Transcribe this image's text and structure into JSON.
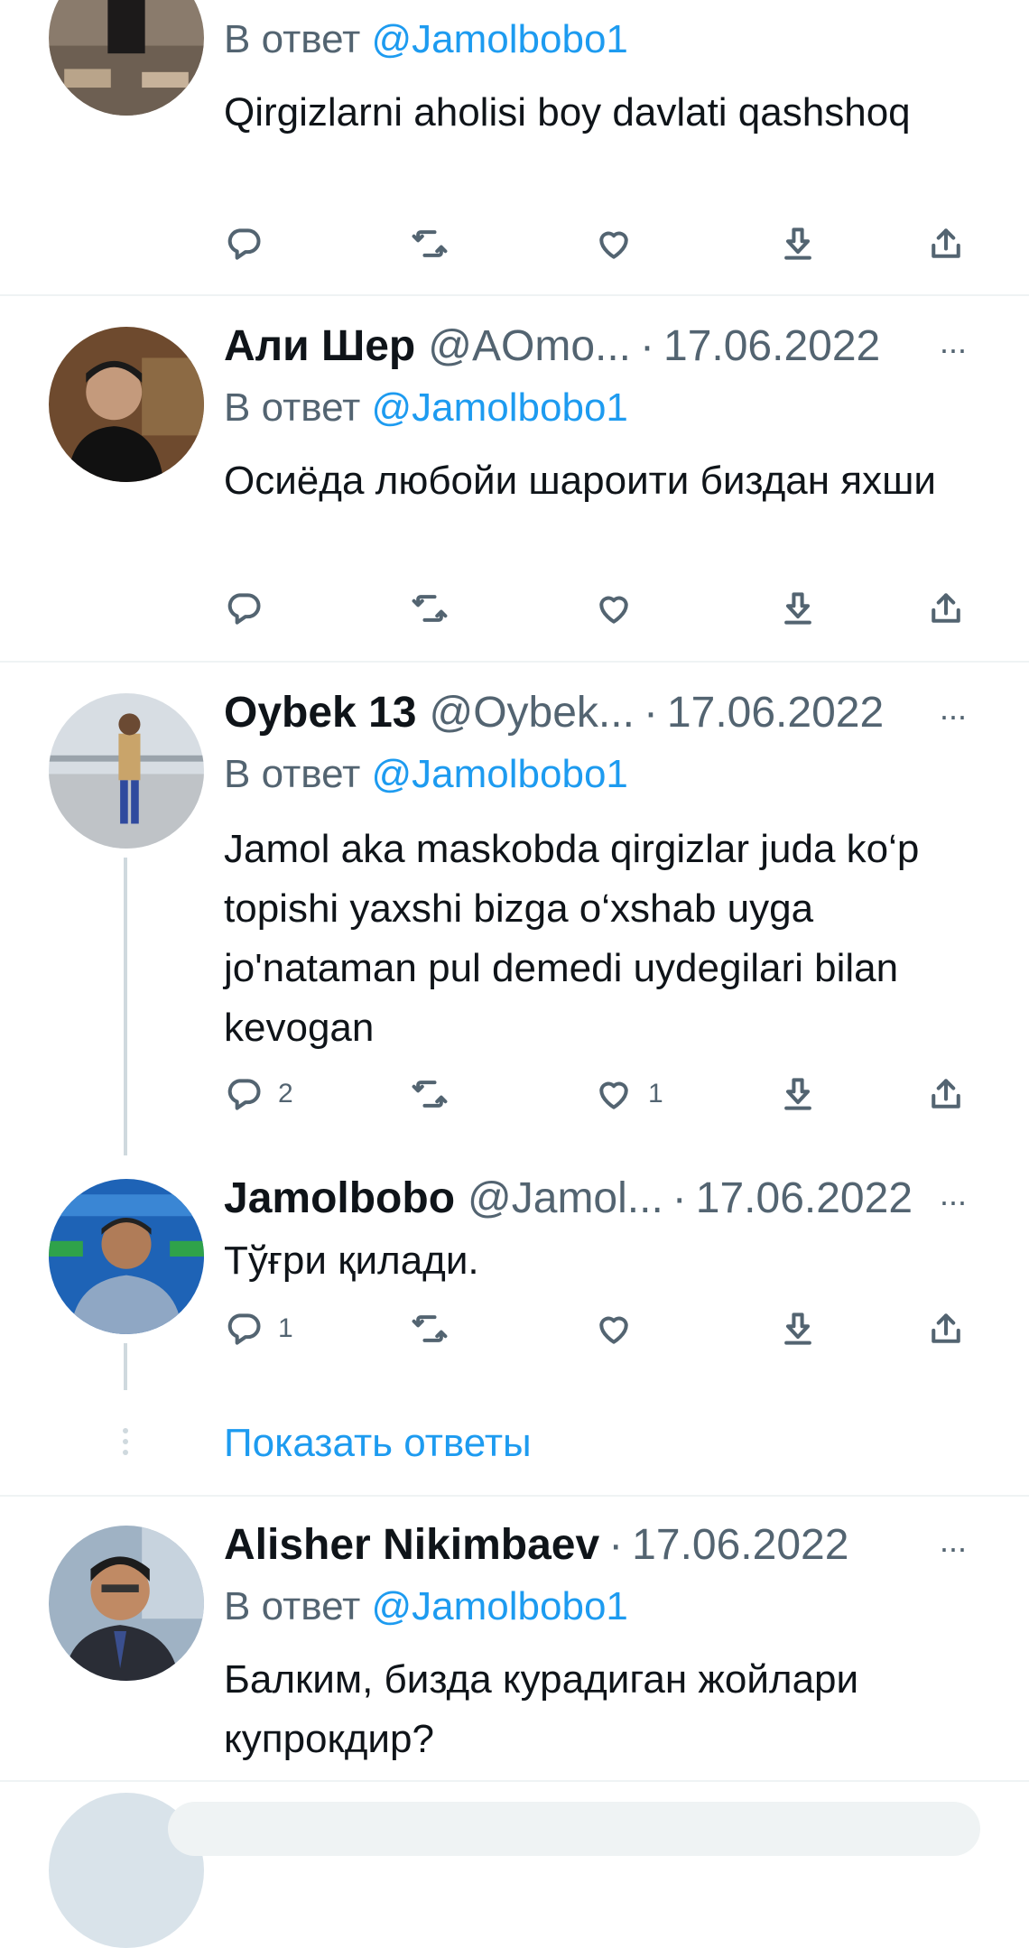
{
  "tweets": [
    {
      "reply_prefix": "В ответ",
      "reply_to": "@Jamolbobo1",
      "text": "Qirgizlarni aholisi boy davlati qashshoq",
      "actions": {
        "reply": "",
        "retweet": "",
        "like": ""
      }
    },
    {
      "name": "Али Шер",
      "handle": "@AOmo...",
      "sep": "·",
      "date": "17.06.2022",
      "reply_prefix": "В ответ",
      "reply_to": "@Jamolbobo1",
      "text": "Осиёда любойи шароити биздан яхши",
      "actions": {
        "reply": "",
        "retweet": "",
        "like": ""
      }
    },
    {
      "name": "Oybek 13",
      "handle": "@Oybek...",
      "sep": "·",
      "date": "17.06.2022",
      "reply_prefix": "В ответ",
      "reply_to": "@Jamolbobo1",
      "text": "Jamol aka maskobda qirgizlar juda ko‘p topishi yaxshi bizga o‘xshab uyga jo'nataman pul demedi uydegilari bilan kevogan",
      "actions": {
        "reply": "2",
        "retweet": "",
        "like": "1"
      }
    },
    {
      "name": "Jamolbobo",
      "handle": "@Jamol...",
      "sep": "·",
      "date": "17.06.2022",
      "text": "Тўғри қилади.",
      "actions": {
        "reply": "1",
        "retweet": "",
        "like": ""
      }
    },
    {
      "name": "Alisher Nikimbaev",
      "sep": "·",
      "date": "17.06.2022",
      "reply_prefix": "В ответ",
      "reply_to": "@Jamolbobo1",
      "text": "Балким, бизда курадиган жойлари купрокдир?"
    }
  ],
  "show_replies": "Показать ответы",
  "more_glyph": "···",
  "colors": {
    "accent": "#1d9bf0",
    "secondary": "#536471",
    "divider": "#eff3f4"
  },
  "icons": [
    "reply-icon",
    "retweet-icon",
    "like-icon",
    "download-icon",
    "share-icon",
    "more-icon"
  ]
}
